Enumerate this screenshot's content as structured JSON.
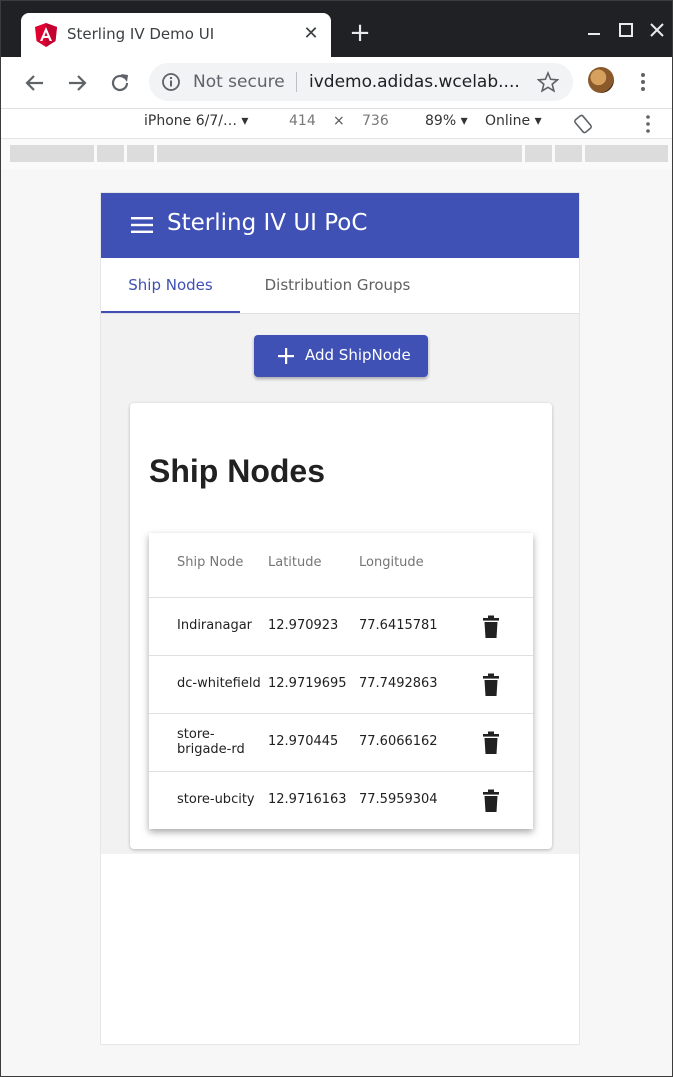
{
  "browser": {
    "tab_title": "Sterling IV Demo UI",
    "security_label": "Not secure",
    "url": "ivdemo.adidas.wcelab....",
    "device": "iPhone 6/7/…",
    "width": "414",
    "times": "×",
    "height": "736",
    "zoom": "89%",
    "network": "Online"
  },
  "app": {
    "title": "Sterling IV UI PoC",
    "tabs": [
      {
        "label": "Ship Nodes"
      },
      {
        "label": "Distribution Groups"
      }
    ],
    "add_button_label": "Add ShipNode",
    "card_title": "Ship Nodes",
    "table": {
      "headers": [
        "Ship Node",
        "Latitude",
        "Longitude"
      ],
      "rows": [
        {
          "node": "Indiranagar",
          "lat": "12.970923",
          "lng": "77.6415781"
        },
        {
          "node": "dc-whitefield",
          "lat": "12.9719695",
          "lng": "77.7492863"
        },
        {
          "node": "store-brigade-rd",
          "lat": "12.970445",
          "lng": "77.6066162"
        },
        {
          "node": "store-ubcity",
          "lat": "12.9716163",
          "lng": "77.5959304"
        }
      ]
    }
  },
  "colors": {
    "primary": "#3f51b5",
    "titlebar": "#202124",
    "angular_red": "#dd0031"
  }
}
